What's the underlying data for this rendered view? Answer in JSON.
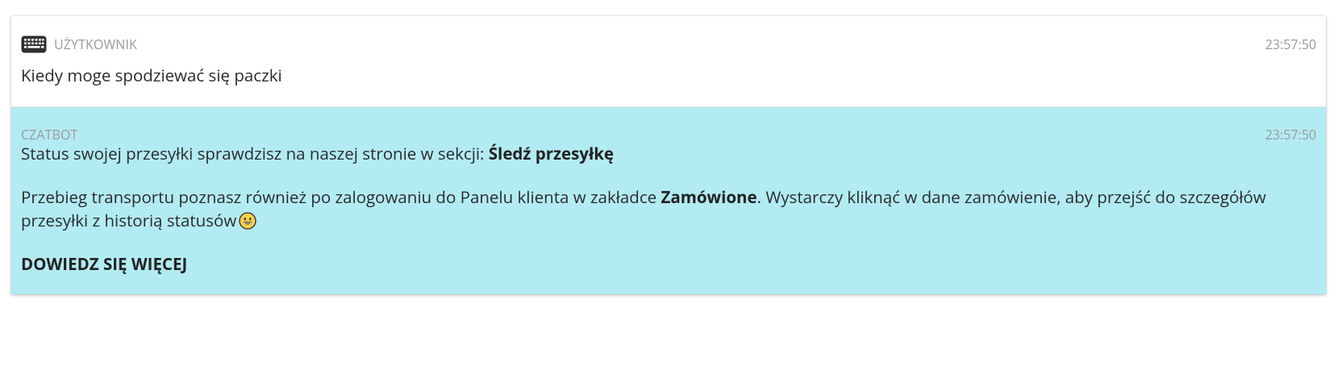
{
  "user_message": {
    "sender": "UŻYTKOWNIK",
    "time": "23:57:50",
    "text": "Kiedy moge spodziewać się paczki",
    "icon": "keyboard-icon"
  },
  "bot_message": {
    "sender": "CZATBOT",
    "time": "23:57:50",
    "line1_prefix": "Status swojej przesyłki sprawdzisz na naszej stronie w sekcji: ",
    "line1_bold": "Śledź przesyłkę",
    "line2_prefix": "Przebieg transportu poznasz również po zalogowaniu do Panelu klienta w zakładce ",
    "line2_bold": "Zamówione",
    "line2_suffix": ". Wystarczy kliknąć w dane zamówienie, aby przejść do szczegółów przesyłki z historią statusów",
    "emoji": "grinning-face-emoji",
    "learn_more": "DOWIEDZ SIĘ WIĘCEJ",
    "background_color": "#b2ebf2"
  }
}
